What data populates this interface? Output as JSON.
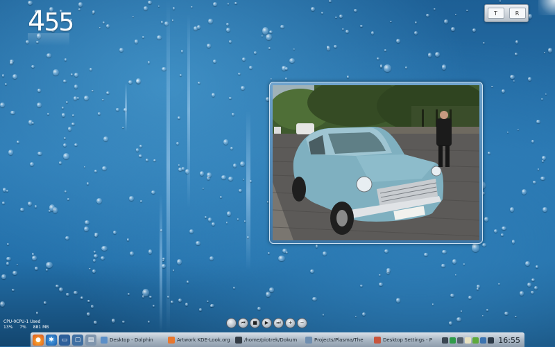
{
  "clock": {
    "hours": "4",
    "minutes": "55"
  },
  "top_right_widget": {
    "left_label": "T",
    "right_label": "R"
  },
  "cpu_monitor": {
    "title": "CPU-0CPU-1 Used",
    "cpu0": "13%",
    "cpu1": "7%",
    "mem": "881 MB"
  },
  "media_controls": [
    {
      "name": "media-player-icon",
      "glyph": ""
    },
    {
      "name": "previous-icon",
      "glyph": "⏮"
    },
    {
      "name": "stop-icon",
      "glyph": "■"
    },
    {
      "name": "play-icon",
      "glyph": "▶"
    },
    {
      "name": "next-icon",
      "glyph": "⏭"
    },
    {
      "name": "volume-up-icon",
      "glyph": "+"
    },
    {
      "name": "volume-down-icon",
      "glyph": "−"
    }
  ],
  "taskbar": {
    "tasks": [
      {
        "label": "Desktop - Dolphin",
        "icon_color": "#5b8fc8"
      },
      {
        "label": "Artwork KDE-Look.org",
        "icon_color": "#e8772e"
      },
      {
        "label": "/home/piotrek/Dokum",
        "icon_color": "#333c45"
      },
      {
        "label": "Projects/Plasma/The",
        "icon_color": "#6f8fb1"
      },
      {
        "label": "Desktop Settings - P",
        "icon_color": "#c8553d"
      }
    ],
    "time": "16:55"
  },
  "colors": {
    "accent": "#2a78b3",
    "taskbar": "#a9b6c3"
  }
}
